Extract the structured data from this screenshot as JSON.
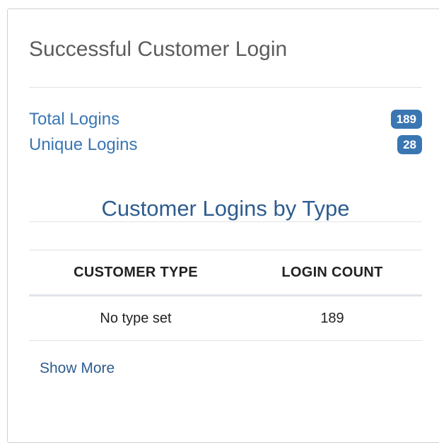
{
  "card": {
    "title": "Successful Customer Login"
  },
  "stats": {
    "total_logins_label": "Total Logins",
    "total_logins_count": "189",
    "unique_logins_label": "Unique Logins",
    "unique_logins_count": "28"
  },
  "section": {
    "title": "Customer Logins by Type"
  },
  "table": {
    "headers": [
      "CUSTOMER TYPE",
      "LOGIN COUNT"
    ],
    "rows": [
      [
        "No type set",
        "189"
      ]
    ]
  },
  "actions": {
    "show_more_label": "Show More"
  },
  "colors": {
    "link": "#3a76b2",
    "badge_bg": "#3a76b2",
    "subtitle": "#2e5d8f",
    "title": "#5c5c5c"
  }
}
